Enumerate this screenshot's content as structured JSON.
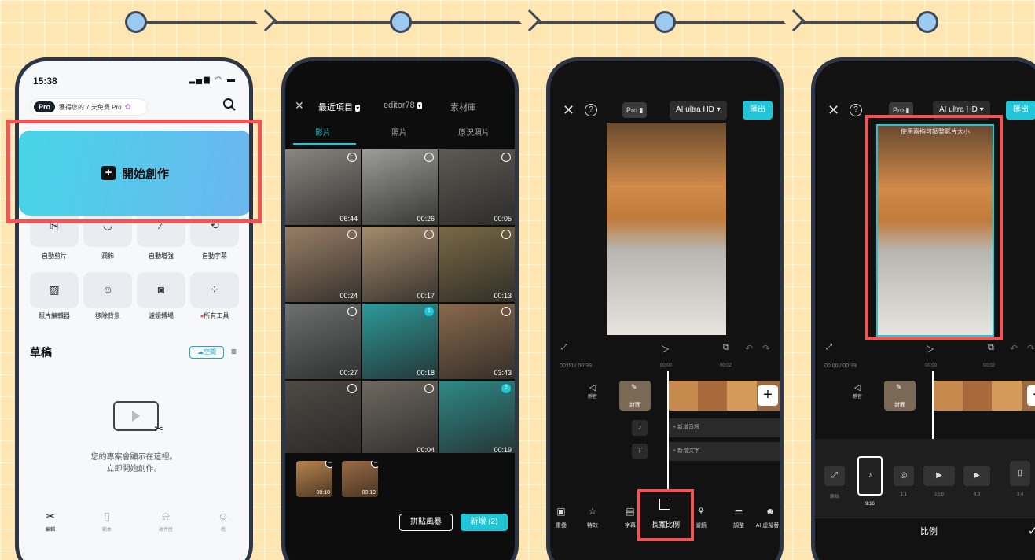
{
  "colors": {
    "highlight": "#f05454",
    "accent": "#20c6d8",
    "background": "#fde6b2",
    "flow_line": "#3d4a5c",
    "flow_node": "#9cc9ef"
  },
  "phone1": {
    "status_time": "15:38",
    "status_icons": "signal-icon wifi-icon battery-icon",
    "pro_badge": "Pro",
    "pro_text": "獲得您的 7 天免費 Pro",
    "pro_flower_icon": "flower-icon",
    "search_icon": "search-icon",
    "start_create": "開始創作",
    "tools": [
      {
        "label": "自動剪片",
        "icon": "auto-cut-icon"
      },
      {
        "label": "潤飾",
        "icon": "retouch-icon"
      },
      {
        "label": "自動增強",
        "icon": "magic-wand-icon"
      },
      {
        "label": "自動字幕",
        "icon": "auto-caption-icon"
      },
      {
        "label": "照片編輯器",
        "icon": "photo-editor-icon"
      },
      {
        "label": "移除背景",
        "icon": "remove-bg-icon"
      },
      {
        "label": "濾鏡轉場",
        "icon": "camera-icon"
      },
      {
        "label": "所有工具",
        "icon": "grid-icon"
      }
    ],
    "drafts_title": "草稿",
    "space_btn": "空間",
    "empty_line1": "您的專案會顯示在這裡。",
    "empty_line2": "立即開始創作。",
    "tabs": [
      {
        "label": "編輯",
        "icon": "scissors-icon"
      },
      {
        "label": "範本",
        "icon": "template-icon"
      },
      {
        "label": "收件匣",
        "icon": "bell-icon"
      },
      {
        "label": "我",
        "icon": "person-icon"
      }
    ]
  },
  "phone2": {
    "top_tabs": [
      "最近項目",
      "editor78",
      "素材庫"
    ],
    "media_tabs": [
      "影片",
      "照片",
      "原況照片"
    ],
    "grid": [
      {
        "dur": "06:44",
        "color": "#8b8680",
        "sel": ""
      },
      {
        "dur": "00:26",
        "color": "#9c9c98",
        "sel": ""
      },
      {
        "dur": "00:05",
        "color": "#5c5a52",
        "sel": ""
      },
      {
        "dur": "00:24",
        "color": "#9a7f66",
        "sel": ""
      },
      {
        "dur": "00:17",
        "color": "#a58b6c",
        "sel": ""
      },
      {
        "dur": "00:13",
        "color": "#7a6a45",
        "sel": ""
      },
      {
        "dur": "00:27",
        "color": "#6d7170",
        "sel": ""
      },
      {
        "dur": "00:18",
        "color": "#2e9a9a",
        "sel": "1"
      },
      {
        "dur": "03:43",
        "color": "#8a6a4c",
        "sel": ""
      },
      {
        "dur": "",
        "color": "#4e4a44",
        "sel": ""
      },
      {
        "dur": "00:04",
        "color": "#6f6a60",
        "sel": ""
      },
      {
        "dur": "00:19",
        "color": "#2f8a88",
        "sel": "2"
      }
    ],
    "tray": [
      {
        "dur": "00:18",
        "color": "#b78350"
      },
      {
        "dur": "00:19",
        "color": "#9a6a48"
      }
    ],
    "collage": "拼貼風暴",
    "add": "新增 (2)"
  },
  "phone3": {
    "pro": "Pro",
    "quality": "AI ultra HD",
    "export": "匯出",
    "timecode": "00:00 / 00:39",
    "ticks": [
      "00:00",
      "00:02"
    ],
    "mute_label": "靜音",
    "cover_label": "封面",
    "add_audio": "新增音訊",
    "add_text": "新增文字",
    "tools": [
      "重疊",
      "特效",
      "字幕",
      "長寬比例",
      "濾鏡",
      "調整",
      "AI 虛擬替身"
    ]
  },
  "phone4": {
    "pro": "Pro",
    "quality": "AI ultra HD",
    "export": "匯出",
    "hint": "使用兩指可調整影片大小",
    "timecode": "00:00 / 00:39",
    "ticks": [
      "00:00",
      "00:02"
    ],
    "mute_label": "靜音",
    "cover_label": "封面",
    "ratios": [
      {
        "label": "原始",
        "glyph": "⤢"
      },
      {
        "label": "9:16",
        "glyph": "♪"
      },
      {
        "label": "1:1",
        "glyph": "◎"
      },
      {
        "label": "16:9",
        "glyph": "▶"
      },
      {
        "label": "4:3",
        "glyph": "▶"
      },
      {
        "label": "3:4",
        "glyph": "▯"
      }
    ],
    "footer_title": "比例",
    "confirm_icon": "check-icon"
  }
}
